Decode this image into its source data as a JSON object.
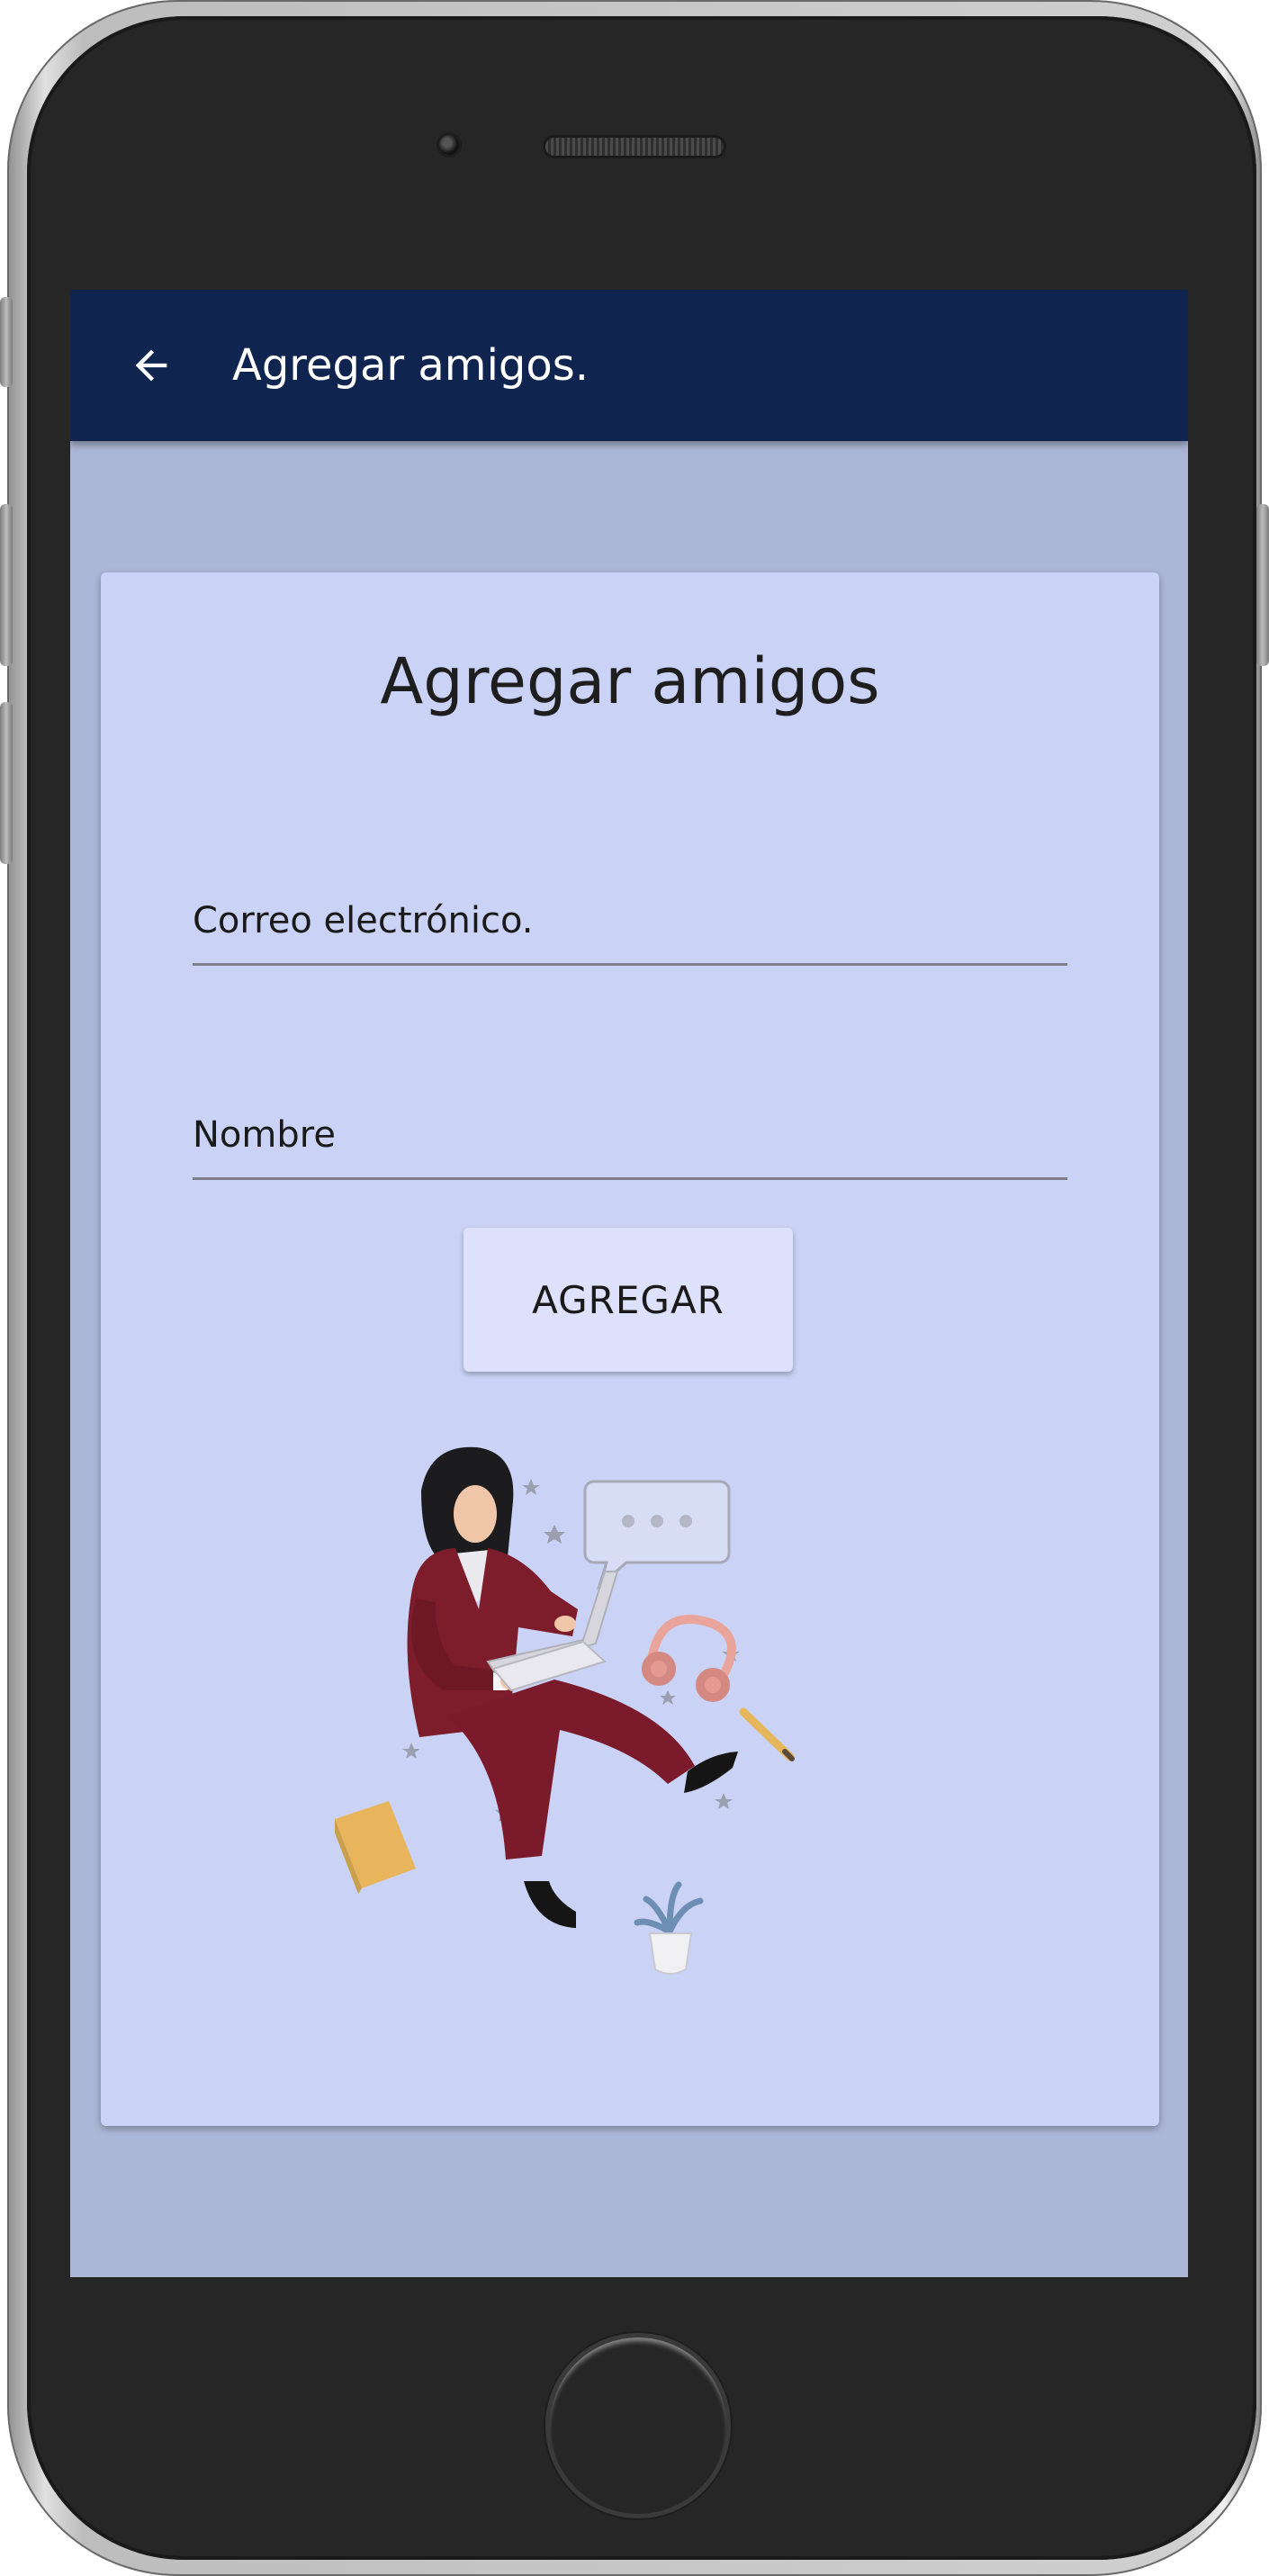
{
  "app_bar": {
    "title": "Agregar amigos."
  },
  "card": {
    "title": "Agregar amigos",
    "email_field": {
      "placeholder": "Correo electrónico.",
      "value": ""
    },
    "name_field": {
      "placeholder": "Nombre",
      "value": ""
    },
    "add_button_label": "AGREGAR"
  },
  "colors": {
    "app_bar": "#0f2550",
    "screen_background": "#acb6d6",
    "card_background": "#cad3f5",
    "button_background": "#dde1fb"
  }
}
